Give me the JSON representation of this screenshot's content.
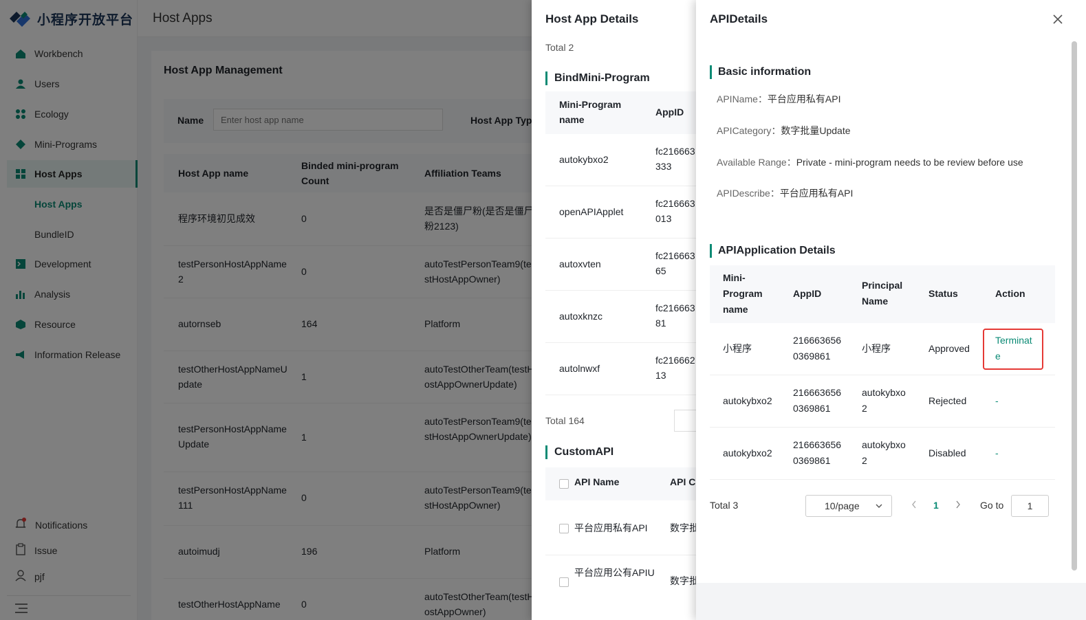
{
  "app": {
    "logo_text": "小程序开放平台",
    "page_title": "Host Apps",
    "brand_color": "#0a8a74"
  },
  "sidebar": {
    "items": [
      {
        "label": "Workbench",
        "icon": "home-icon"
      },
      {
        "label": "Users",
        "icon": "user-icon"
      },
      {
        "label": "Ecology",
        "icon": "grid-icon"
      },
      {
        "label": "Mini-Programs",
        "icon": "diamond-icon"
      },
      {
        "label": "Host Apps",
        "icon": "apps-icon"
      },
      {
        "label": "Development",
        "icon": "code-icon"
      },
      {
        "label": "Analysis",
        "icon": "chart-icon"
      },
      {
        "label": "Resource",
        "icon": "cube-icon"
      },
      {
        "label": "Information Release",
        "icon": "megaphone-icon"
      }
    ],
    "sub_items": [
      "Host Apps",
      "BundleID"
    ],
    "bottom": {
      "notifications": "Notifications",
      "issue": "Issue",
      "user": "pjf"
    }
  },
  "main": {
    "card_title": "Host App Management",
    "filter_name_label": "Name",
    "filter_name_placeholder": "Enter host app name",
    "filter_type_label": "Host App Typ",
    "columns": [
      "Host App name",
      "Binded mini-program Count",
      "Affiliation Teams"
    ],
    "rows": [
      {
        "name": "程序环境初见成效",
        "count": "0",
        "team": "是否是僵尸粉(是否是僵尸粉2123)"
      },
      {
        "name": "testPersonHostAppName2",
        "count": "0",
        "team": "autoTestPersonTeam9(testHostAppOwner)"
      },
      {
        "name": "autornseb",
        "count": "164",
        "team": "Platform"
      },
      {
        "name": "testOtherHostAppNameUpdate",
        "count": "1",
        "team": "autoTestOtherTeam(testHostAppOwnerUpdate)"
      },
      {
        "name": "testPersonHostAppNameUpdate",
        "count": "1",
        "team": "autoTestPersonTeam9(testHostAppOwnerUpdate)"
      },
      {
        "name": "testPersonHostAppName111",
        "count": "0",
        "team": "autoTestPersonTeam9(testHostAppOwner)"
      },
      {
        "name": "autoimudj",
        "count": "196",
        "team": "Platform"
      },
      {
        "name": "testOtherHostAppName",
        "count": "0",
        "team": "autoTestOtherTeam(testHostAppOwner)"
      }
    ]
  },
  "host_app_details": {
    "title": "Host App Details",
    "total": "Total 2",
    "bind_section": "BindMini-Program",
    "bind_columns": [
      "Mini-Program name",
      "AppID"
    ],
    "bind_rows": [
      {
        "name": "autokybxo2",
        "appid": "fc216663333"
      },
      {
        "name": "openAPIApplet",
        "appid": "fc216663013"
      },
      {
        "name": "autoxvten",
        "appid": "fc21666365"
      },
      {
        "name": "autoxknzc",
        "appid": "fc21666381"
      },
      {
        "name": "autolnwxf",
        "appid": "fc21666213"
      }
    ],
    "bind_total": "Total 164",
    "custom_section": "CustomAPI",
    "custom_columns": [
      "API Name",
      "API C"
    ],
    "custom_rows": [
      {
        "name": "平台应用私有API",
        "cat": "数字批"
      },
      {
        "name": "平台应用公有APIU",
        "cat": "数字批"
      }
    ]
  },
  "api_details": {
    "title": "APIDetails",
    "basic_section": "Basic information",
    "basic": [
      {
        "key": "APIName：",
        "value": "平台应用私有API"
      },
      {
        "key": "APICategory：",
        "value": "数字批量Update"
      },
      {
        "key": "Available Range：",
        "value": "Private - mini-program needs to be review before use"
      },
      {
        "key": "APIDescribe：",
        "value": "平台应用私有API"
      }
    ],
    "application_section": "APIApplication Details",
    "columns": [
      "Mini-Program name",
      "AppID",
      "Principal Name",
      "Status",
      "Action"
    ],
    "rows": [
      {
        "name": "小程序",
        "appid": "2166636560369861",
        "principal": "小程序",
        "status": "Approved",
        "action": "Terminate"
      },
      {
        "name": "autokybxo2",
        "appid": "2166636560369861",
        "principal": "autokybxo2",
        "status": "Rejected",
        "action": "-"
      },
      {
        "name": "autokybxo2",
        "appid": "2166636560369861",
        "principal": "autokybxo2",
        "status": "Disabled",
        "action": "-"
      }
    ],
    "pagination": {
      "total": "Total 3",
      "page_size": "10/page",
      "current": "1",
      "goto_label": "Go to",
      "goto_value": "1"
    }
  }
}
